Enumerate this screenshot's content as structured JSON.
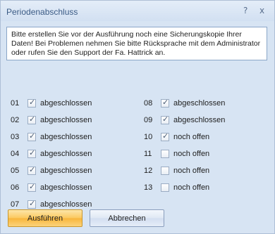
{
  "window": {
    "title": "Periodenabschluss",
    "help_icon": "?",
    "close_icon": "x"
  },
  "info": {
    "text": "Bitte erstellen Sie vor der Ausführung noch eine Sicherungskopie Ihrer Daten! Bei Problemen nehmen Sie bitte Rücksprache mit dem Administrator oder rufen Sie den Support der Fa. Hattrick an."
  },
  "periods": [
    {
      "num": "01",
      "checked": true,
      "label": "abgeschlossen"
    },
    {
      "num": "02",
      "checked": true,
      "label": "abgeschlossen"
    },
    {
      "num": "03",
      "checked": true,
      "label": "abgeschlossen"
    },
    {
      "num": "04",
      "checked": true,
      "label": "abgeschlossen"
    },
    {
      "num": "05",
      "checked": true,
      "label": "abgeschlossen"
    },
    {
      "num": "06",
      "checked": true,
      "label": "abgeschlossen"
    },
    {
      "num": "07",
      "checked": true,
      "label": "abgeschlossen"
    },
    {
      "num": "08",
      "checked": true,
      "label": "abgeschlossen"
    },
    {
      "num": "09",
      "checked": true,
      "label": "abgeschlossen"
    },
    {
      "num": "10",
      "checked": true,
      "label": "noch offen"
    },
    {
      "num": "11",
      "checked": false,
      "label": "noch offen"
    },
    {
      "num": "12",
      "checked": false,
      "label": "noch offen"
    },
    {
      "num": "13",
      "checked": false,
      "label": "noch offen"
    }
  ],
  "buttons": {
    "execute": "Ausführen",
    "cancel": "Abbrechen"
  }
}
